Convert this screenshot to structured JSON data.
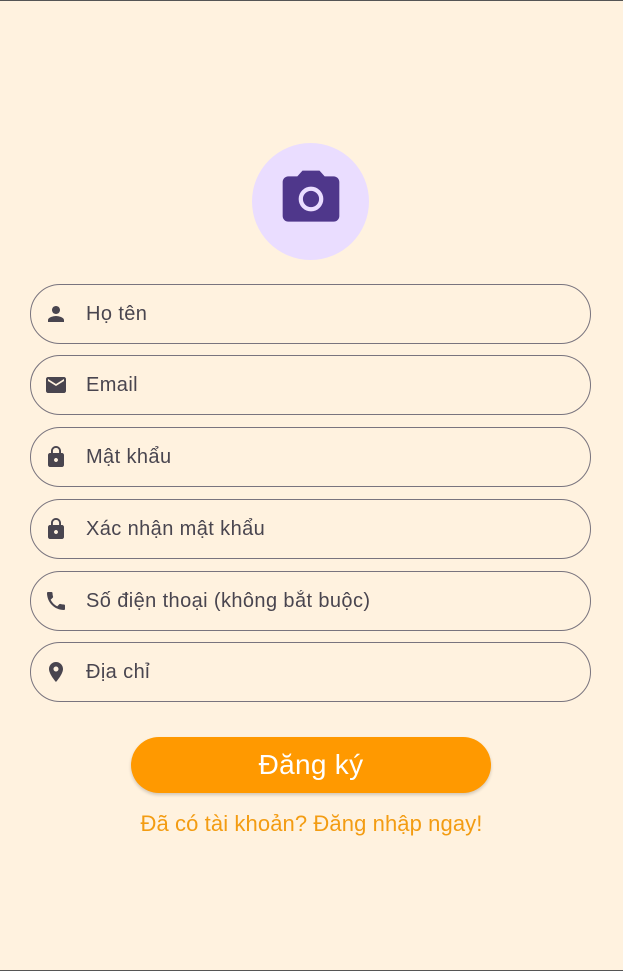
{
  "avatar": {
    "icon": "camera-icon"
  },
  "fields": [
    {
      "icon": "person-icon",
      "placeholder": "Họ tên",
      "value": ""
    },
    {
      "icon": "mail-icon",
      "placeholder": "Email",
      "value": ""
    },
    {
      "icon": "lock-icon",
      "placeholder": "Mật khẩu",
      "value": ""
    },
    {
      "icon": "lock-icon",
      "placeholder": "Xác nhận mật khẩu",
      "value": ""
    },
    {
      "icon": "phone-icon",
      "placeholder": "Số điện thoại (không bắt buộc)",
      "value": ""
    },
    {
      "icon": "location-pin-icon",
      "placeholder": "Địa chỉ",
      "value": ""
    }
  ],
  "register_button": {
    "label": "Đăng ký"
  },
  "login_link": {
    "label": "Đã có tài khoản? Đăng nhập ngay!"
  },
  "colors": {
    "background": "#FFF2DF",
    "avatar_bg": "#EADDFF",
    "camera": "#4F378B",
    "outline": "#79747E",
    "icon": "#49454F",
    "primary": "#FF9900",
    "link": "#F39C12"
  }
}
